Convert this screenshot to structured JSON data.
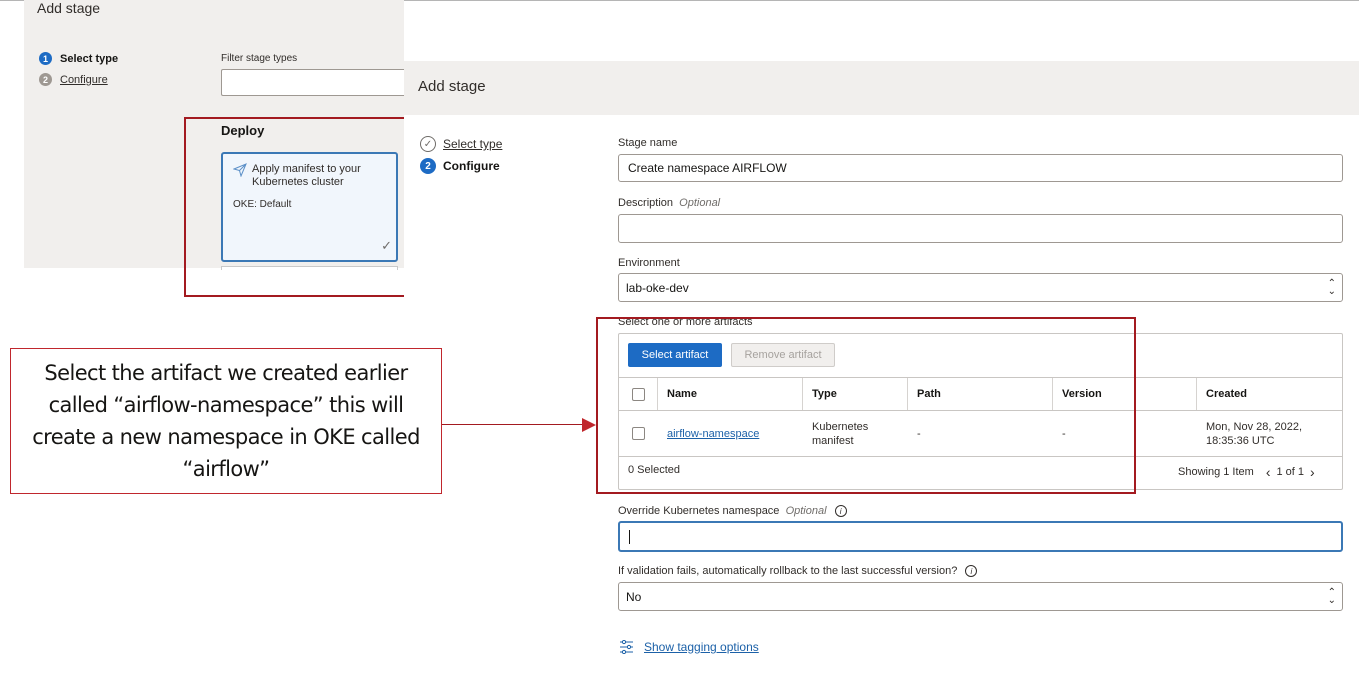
{
  "background_screen": {
    "title": "Add stage",
    "steps": [
      {
        "num": "1",
        "label": "Select type"
      },
      {
        "num": "2",
        "label": "Configure"
      }
    ],
    "filter_label": "Filter stage types",
    "section_title": "Deploy",
    "card": {
      "title": "Apply manifest to your Kubernetes cluster",
      "subtitle": "OKE: Default",
      "check": "✓"
    }
  },
  "dialog": {
    "title": "Add stage",
    "steps": [
      {
        "label": "Select type",
        "icon": "check-circle-icon"
      },
      {
        "num": "2",
        "label": "Configure"
      }
    ],
    "stage_name": {
      "label": "Stage name",
      "value": "Create namespace AIRFLOW"
    },
    "description": {
      "label": "Description",
      "optional": "Optional",
      "value": ""
    },
    "environment": {
      "label": "Environment",
      "value": "lab-oke-dev"
    },
    "artifacts": {
      "label": "Select one or more artifacts",
      "select_button": "Select artifact",
      "remove_button": "Remove artifact",
      "columns": [
        "Name",
        "Type",
        "Path",
        "Version",
        "Created"
      ],
      "rows": [
        {
          "name": "airflow-namespace",
          "type_line1": "Kubernetes",
          "type_line2": "manifest",
          "path": "-",
          "version": "-",
          "created_line1": "Mon, Nov 28, 2022,",
          "created_line2": "18:35:36 UTC"
        }
      ],
      "selected_count": "0 Selected",
      "showing": "Showing 1 Item",
      "pagination": "1 of 1"
    },
    "override_namespace": {
      "label": "Override Kubernetes namespace",
      "optional": "Optional",
      "value": ""
    },
    "rollback": {
      "label": "If validation fails, automatically rollback to the last successful version?",
      "value": "No"
    },
    "tagging_link": "Show tagging options"
  },
  "callout": {
    "text": "Select the artifact we created earlier called “airflow-namespace” this will create a new namespace in OKE called “airflow”"
  },
  "colors": {
    "accent": "#1c61a8",
    "primary_button": "#1d6bc4",
    "annotation_red": "#a31a20"
  }
}
